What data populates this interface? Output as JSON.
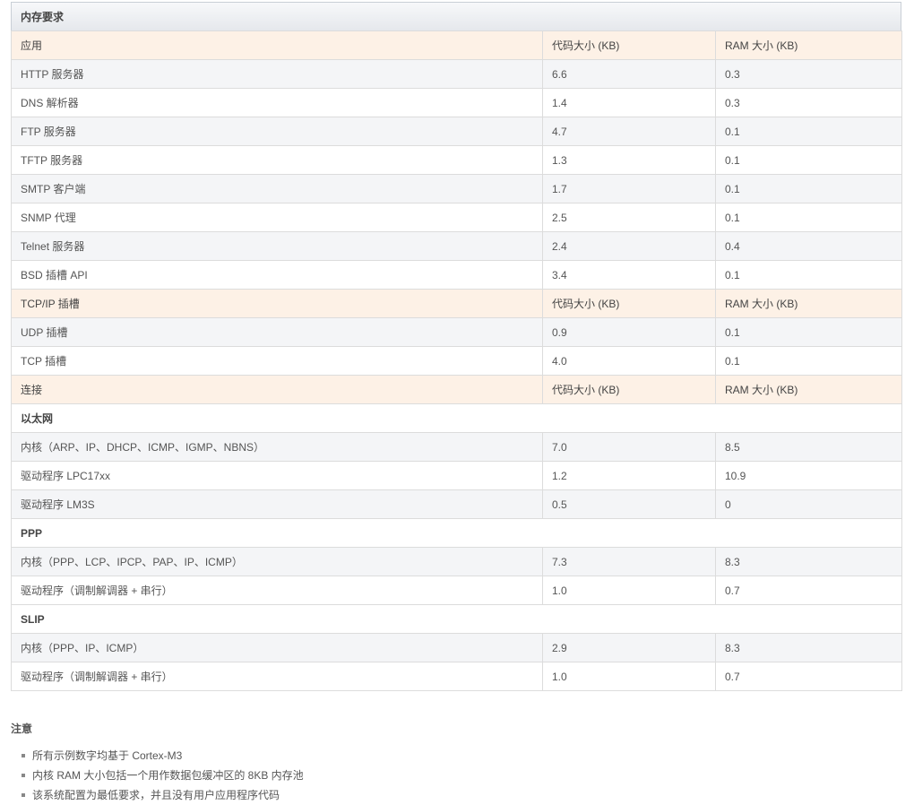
{
  "caption": "内存要求",
  "rows": [
    {
      "kind": "hdr",
      "cells": [
        "应用",
        "代码大小 (KB)",
        "RAM 大小 (KB)"
      ]
    },
    {
      "kind": "row",
      "cells": [
        "HTTP 服务器",
        "6.6",
        "0.3"
      ]
    },
    {
      "kind": "row",
      "cells": [
        "DNS 解析器",
        "1.4",
        "0.3"
      ]
    },
    {
      "kind": "row",
      "cells": [
        "FTP 服务器",
        "4.7",
        "0.1"
      ]
    },
    {
      "kind": "row",
      "cells": [
        "TFTP 服务器",
        "1.3",
        "0.1"
      ]
    },
    {
      "kind": "row",
      "cells": [
        "SMTP 客户端",
        "1.7",
        "0.1"
      ]
    },
    {
      "kind": "row",
      "cells": [
        "SNMP 代理",
        "2.5",
        "0.1"
      ]
    },
    {
      "kind": "row",
      "cells": [
        "Telnet 服务器",
        "2.4",
        "0.4"
      ]
    },
    {
      "kind": "row",
      "cells": [
        "BSD 插槽 API",
        "3.4",
        "0.1"
      ]
    },
    {
      "kind": "hdr",
      "cells": [
        "TCP/IP 插槽",
        "代码大小 (KB)",
        "RAM 大小 (KB)"
      ]
    },
    {
      "kind": "row",
      "cells": [
        "UDP 插槽",
        "0.9",
        "0.1"
      ]
    },
    {
      "kind": "row",
      "cells": [
        "TCP 插槽",
        "4.0",
        "0.1"
      ]
    },
    {
      "kind": "hdr",
      "cells": [
        "连接",
        "代码大小 (KB)",
        "RAM 大小 (KB)"
      ]
    },
    {
      "kind": "sec",
      "cells": [
        "以太网"
      ]
    },
    {
      "kind": "row",
      "cells": [
        "内核（ARP、IP、DHCP、ICMP、IGMP、NBNS）",
        "7.0",
        "8.5"
      ]
    },
    {
      "kind": "row",
      "cells": [
        "驱动程序 LPC17xx",
        "1.2",
        "10.9"
      ]
    },
    {
      "kind": "row",
      "cells": [
        "驱动程序 LM3S",
        "0.5",
        "0"
      ]
    },
    {
      "kind": "sec",
      "cells": [
        "PPP"
      ]
    },
    {
      "kind": "row",
      "cells": [
        "内核（PPP、LCP、IPCP、PAP、IP、ICMP）",
        "7.3",
        "8.3"
      ]
    },
    {
      "kind": "row",
      "cells": [
        "驱动程序（调制解调器 + 串行）",
        "1.0",
        "0.7"
      ]
    },
    {
      "kind": "sec",
      "cells": [
        "SLIP"
      ]
    },
    {
      "kind": "row",
      "cells": [
        "内核（PPP、IP、ICMP）",
        "2.9",
        "8.3"
      ]
    },
    {
      "kind": "row",
      "cells": [
        "驱动程序（调制解调器 + 串行）",
        "1.0",
        "0.7"
      ]
    }
  ],
  "notes": {
    "title": "注意",
    "items": [
      "所有示例数字均基于 Cortex-M3",
      "内核 RAM 大小包括一个用作数据包缓冲区的 8KB 内存池",
      "该系统配置为最低要求，并且没有用户应用程序代码"
    ]
  }
}
